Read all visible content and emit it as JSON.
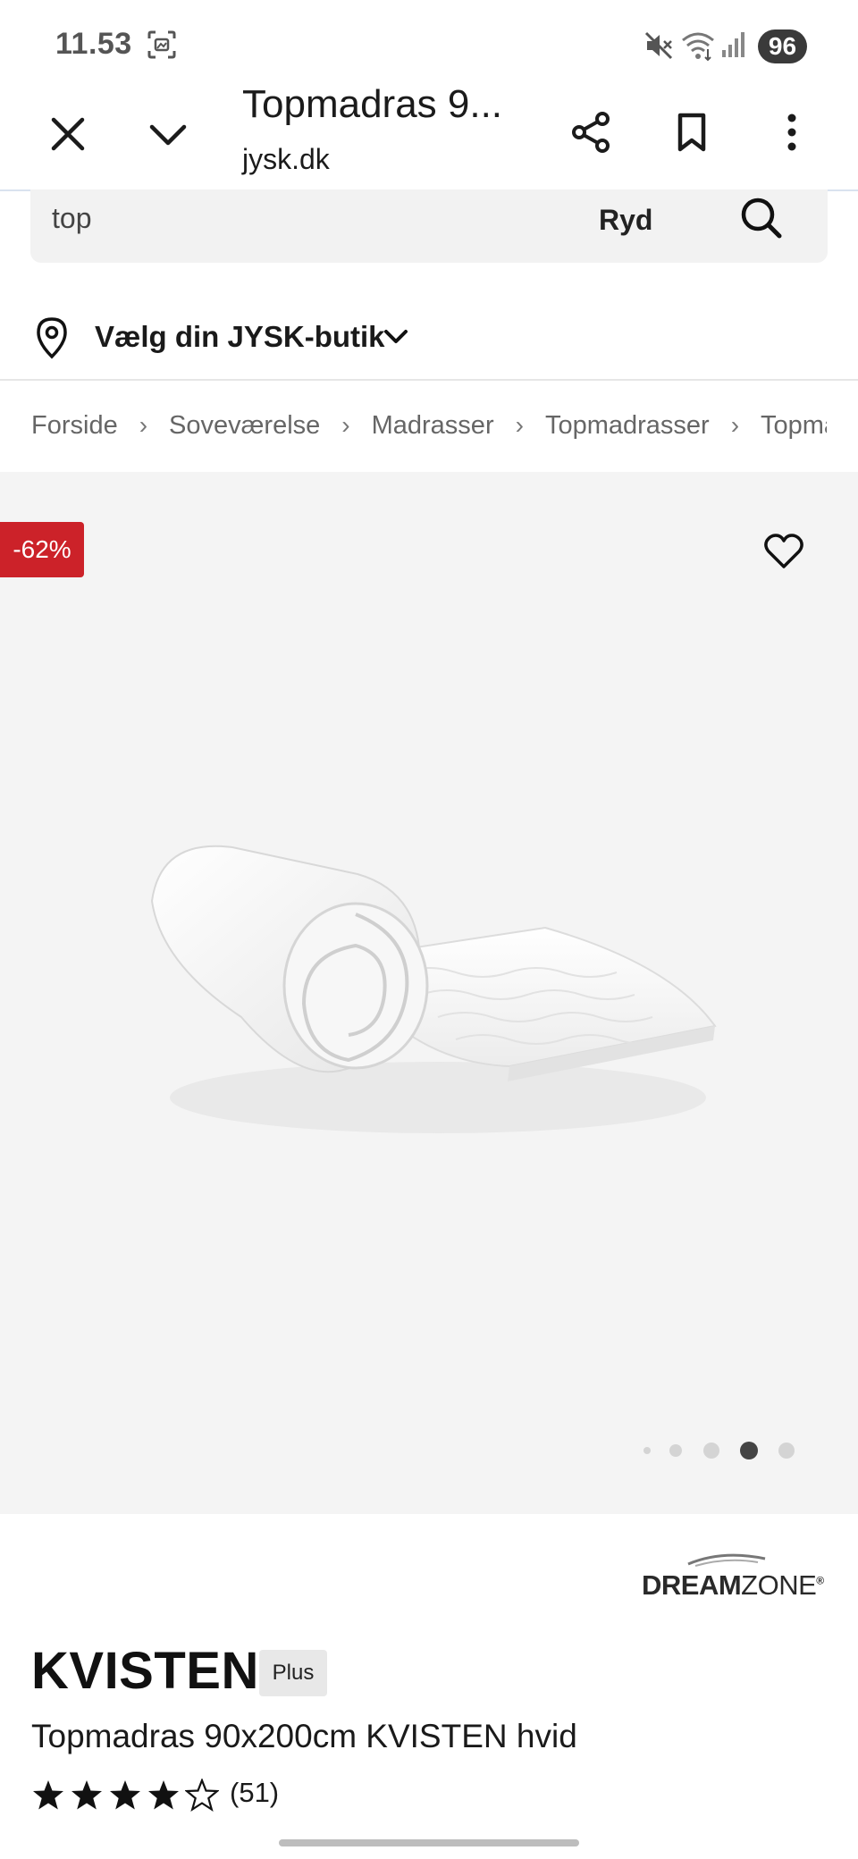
{
  "status_bar": {
    "time": "11.53",
    "battery": "96"
  },
  "browser": {
    "title": "Topmadras 9...",
    "domain": "jysk.dk"
  },
  "search": {
    "value": "top",
    "clear_label": "Ryd"
  },
  "store": {
    "label": "Vælg din JYSK-butik"
  },
  "breadcrumb": [
    "Forside",
    "Soveværelse",
    "Madrasser",
    "Topmadrasser",
    "Topmadrasser"
  ],
  "product": {
    "discount": "-62%",
    "brand_bold": "DREAM",
    "brand_light": "ZONE",
    "brand_mark": "®",
    "name": "KVISTEN",
    "tier_badge": "Plus",
    "description": "Topmadras 90x200cm KVISTEN hvid",
    "rating_value": 4,
    "rating_max": 5,
    "rating_count": "(51)"
  },
  "gallery": {
    "total_images": 5,
    "active_index": 3
  },
  "colors": {
    "discount_red": "#cc2229",
    "gallery_bg": "#f4f4f4",
    "search_bg": "#f2f2f2"
  }
}
